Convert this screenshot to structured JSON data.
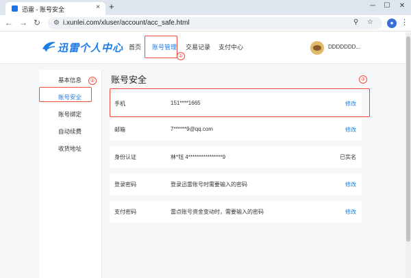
{
  "browser": {
    "tab_title": "迅雷 - 账号安全",
    "close_glyph": "×",
    "new_tab_glyph": "+",
    "url": "i.xunlei.com/xluser/account/acc_safe.html"
  },
  "header": {
    "logo_text": "迅雷个人中心",
    "nav": [
      "首页",
      "账号管理",
      "交易记录",
      "支付中心"
    ],
    "username": "DDDDDDD...",
    "brand_color": "#1d7ce8"
  },
  "sidebar": {
    "items": [
      "基本信息",
      "账号安全",
      "账号绑定",
      "自动续费",
      "收货地址"
    ]
  },
  "main": {
    "title": "账号安全",
    "rows": [
      {
        "label": "手机",
        "value": "151****1665",
        "action": "修改"
      },
      {
        "label": "邮箱",
        "value": "7******9@qq.com",
        "action": "修改"
      },
      {
        "label": "身份认证",
        "value": "林*钰 4****************9",
        "status": "已实名"
      },
      {
        "label": "登录密码",
        "value": "登录迅雷账号时需要输入的密码",
        "action": "修改"
      },
      {
        "label": "支付密码",
        "value": "雷点账号资金变动时，需要输入的密码",
        "action": "修改"
      }
    ]
  },
  "annotations": [
    "①",
    "②",
    "③"
  ],
  "annotation_color": "#e84b3c"
}
